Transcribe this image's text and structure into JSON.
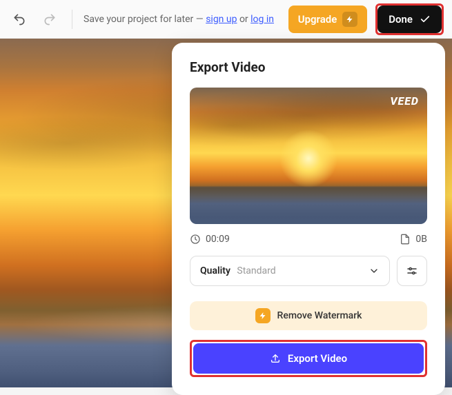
{
  "topbar": {
    "save_prefix": "Save your project for later — ",
    "signup": "sign up",
    "or": " or ",
    "login": "log in",
    "upgrade": "Upgrade",
    "done": "Done"
  },
  "export": {
    "title": "Export Video",
    "watermark": "VEED",
    "duration": "00:09",
    "filesize": "0B",
    "quality_label": "Quality",
    "quality_value": "Standard",
    "remove_watermark": "Remove Watermark",
    "export_button": "Export Video"
  },
  "chart_data": null
}
